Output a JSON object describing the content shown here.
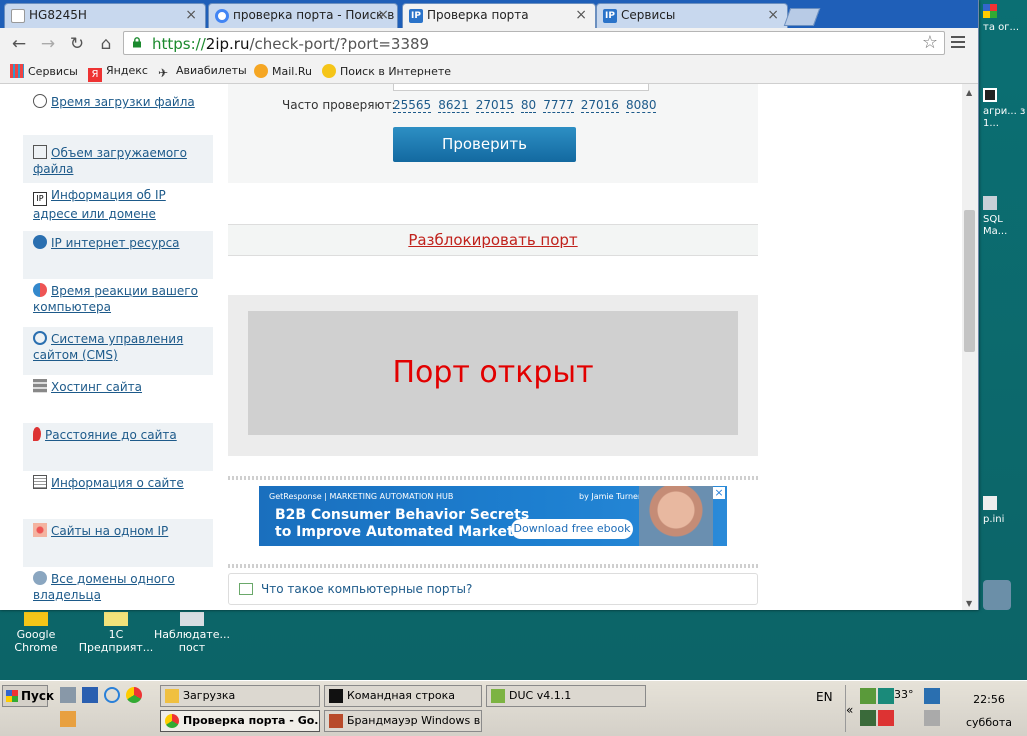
{
  "tabs": [
    {
      "title": "HG8245H",
      "favicon": "blank-page-icon"
    },
    {
      "title": "проверка порта - Поиск в G",
      "favicon": "google-icon"
    },
    {
      "title": "Проверка порта",
      "favicon": "2ip-icon",
      "active": true
    },
    {
      "title": "Сервисы",
      "favicon": "2ip-icon"
    }
  ],
  "address": {
    "scheme": "https://",
    "domain": "2ip.ru",
    "path": "/check-port/?port=3389"
  },
  "bookmarks": [
    {
      "label": "Сервисы",
      "icon": "apps-grid-icon"
    },
    {
      "label": "Яндекс",
      "icon": "yandex-icon"
    },
    {
      "label": "Авиабилеты",
      "icon": "plane-icon"
    },
    {
      "label": "Mail.Ru",
      "icon": "mailru-icon"
    },
    {
      "label": "Поиск в Интернете",
      "icon": "search-web-icon"
    }
  ],
  "sidebar": {
    "items": [
      {
        "label": "Время загрузки файла",
        "icon": "clock-icon"
      },
      {
        "label": "Объем загружаемого файла",
        "icon": "file-size-icon"
      },
      {
        "label": "Информация об IP адресе или домене",
        "icon": "ip-info-icon"
      },
      {
        "label": "IP интернет ресурса",
        "icon": "ip-globe-icon"
      },
      {
        "label": "Время реакции вашего компьютера",
        "icon": "reaction-icon"
      },
      {
        "label": "Система управления сайтом (CMS)",
        "icon": "cms-icon"
      },
      {
        "label": "Хостинг сайта",
        "icon": "hosting-icon"
      },
      {
        "label": "Расстояние до сайта",
        "icon": "map-pin-icon"
      },
      {
        "label": "Информация о сайте",
        "icon": "site-info-icon"
      },
      {
        "label": "Сайты на одном IP",
        "icon": "network-icon"
      },
      {
        "label": "Все домены одного владельца",
        "icon": "owner-icon"
      }
    ]
  },
  "check": {
    "freq_label": "Часто проверяют:",
    "ports": [
      "25565",
      "8621",
      "27015",
      "80",
      "7777",
      "27016",
      "8080"
    ],
    "button": "Проверить"
  },
  "unblock_link": "Разблокировать порт",
  "result": "Порт открыт",
  "ad": {
    "brand": "GetResponse  |  MARKETING AUTOMATION HUB",
    "author": "by Jamie Turner",
    "line1": "B2B Consumer Behavior Secrets",
    "line2": "to Improve Automated Marketing",
    "button": "Download free ebook"
  },
  "faq_link": "Что такое компьютерные порты?",
  "desktop_icons": [
    {
      "label": "Google Chrome"
    },
    {
      "label": "1С Предприят..."
    },
    {
      "label": "Наблюдате... пост"
    }
  ],
  "right_strip": [
    {
      "label": "та ог..."
    },
    {
      "label": "агри... з 1..."
    },
    {
      "label": "SQL Ma..."
    },
    {
      "label": "p.ini"
    }
  ],
  "taskbar": {
    "start": "Пуск",
    "tasks_top": [
      "Загрузка",
      "Командная строка",
      "DUC v4.1.1"
    ],
    "tasks_bottom": [
      "Проверка порта - Go...",
      "Брандмауэр Windows в ..."
    ],
    "lang": "EN",
    "temperature": "33°",
    "time": "22:56",
    "day": "суббота"
  }
}
